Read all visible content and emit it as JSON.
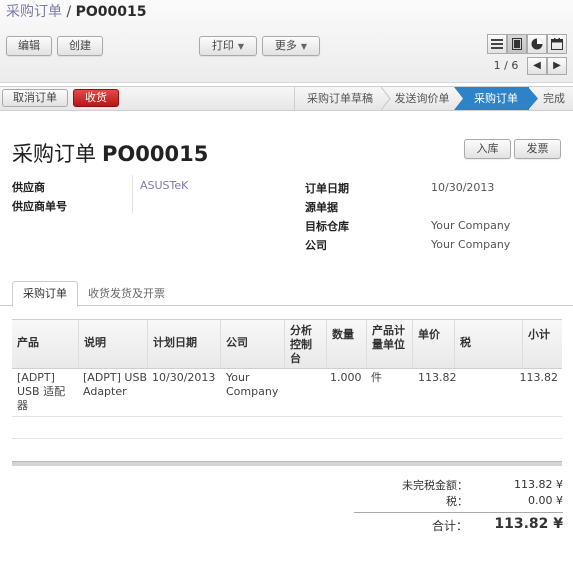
{
  "breadcrumb": {
    "parent": "采购订单",
    "separator": "/",
    "current": "PO00015"
  },
  "toolbar": {
    "edit": "编辑",
    "create": "创建",
    "print": "打印",
    "more": "更多"
  },
  "pager": {
    "text": "1 / 6"
  },
  "view_switcher": [
    "list-icon",
    "form-icon",
    "calendar-icon",
    "graph-icon"
  ],
  "statusbar": {
    "cancel": "取消订单",
    "receive": "收货",
    "stages": [
      "采购订单草稿",
      "发送询价单",
      "采购订单",
      "完成"
    ],
    "active_stage": "采购订单"
  },
  "sheet": {
    "title": "采购订单",
    "number": "PO00015",
    "buttons": {
      "stock_in": "入库",
      "invoice": "发票"
    },
    "left_fields": [
      {
        "label": "供应商",
        "value": "ASUSTeK"
      },
      {
        "label": "供应商单号",
        "value": ""
      }
    ],
    "right_fields": [
      {
        "label": "订单日期",
        "value": "10/30/2013"
      },
      {
        "label": "源单据",
        "value": ""
      },
      {
        "label": "目标仓库",
        "value": "Your Company"
      },
      {
        "label": "公司",
        "value": "Your Company"
      }
    ],
    "tabs": [
      "采购订单",
      "收货发货及开票"
    ]
  },
  "table": {
    "headers": [
      "产品",
      "说明",
      "计划日期",
      "公司",
      "分析控制台",
      "数量",
      "产品计量单位",
      "单价",
      "税",
      "小计"
    ],
    "rows": [
      {
        "product": "[ADPT] USB 适配器",
        "description": "[ADPT] USB Adapter",
        "date": "10/30/2013",
        "company": "Your Company",
        "analytic": "",
        "qty": "1.000",
        "uom": "件",
        "price": "113.82",
        "tax": "",
        "subtotal": "113.82"
      }
    ]
  },
  "totals": {
    "untaxed_label": "未完税金额：",
    "untaxed": "113.82 ¥",
    "tax_label": "税：",
    "tax": "0.00 ¥",
    "total_label": "合计：",
    "total": "113.82 ¥"
  },
  "colors": {
    "accent": "#2c83c7",
    "danger": "#c41e1e",
    "link": "#7c7bad"
  }
}
